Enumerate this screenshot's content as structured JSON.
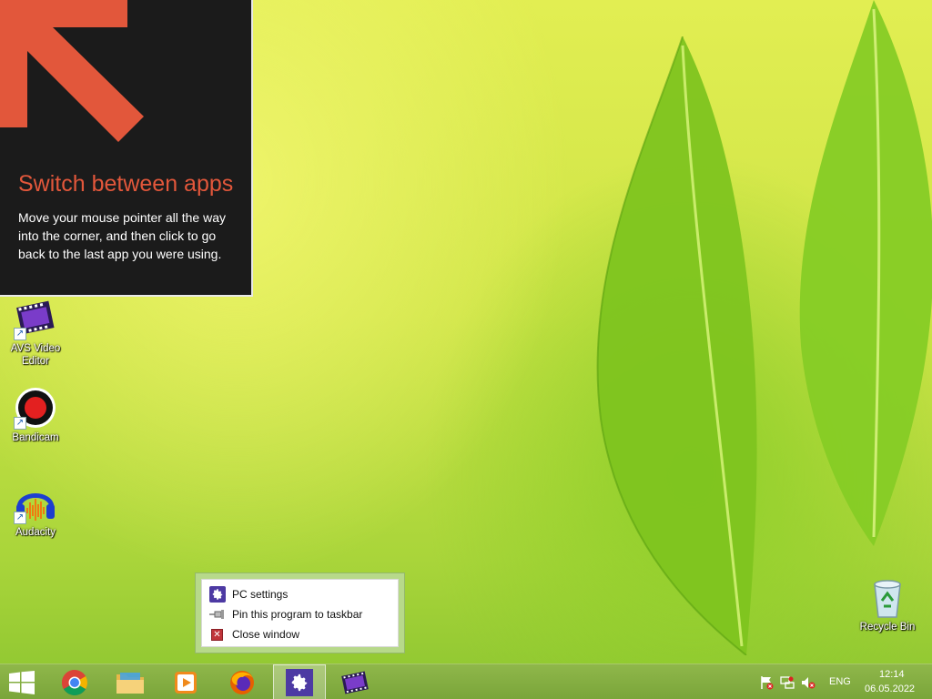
{
  "tip": {
    "title": "Switch between apps",
    "body": "Move your mouse pointer all the way into the corner, and then click to go back to the last app you were using."
  },
  "desktop": {
    "icons": [
      {
        "label": "AVS Video Editor",
        "icon": "film-icon"
      },
      {
        "label": "Bandicam",
        "icon": "record-icon"
      },
      {
        "label": "Audacity",
        "icon": "headphones-icon"
      },
      {
        "label": "Recycle Bin",
        "icon": "recycle-bin-icon"
      }
    ]
  },
  "jumplist": {
    "items": [
      {
        "label": "PC settings",
        "icon": "gear-icon"
      },
      {
        "label": "Pin this program to taskbar",
        "icon": "pin-icon"
      },
      {
        "label": "Close window",
        "icon": "close-icon"
      }
    ]
  },
  "taskbar": {
    "apps": [
      {
        "name": "start-button",
        "icon": "windows-logo-icon"
      },
      {
        "name": "chrome",
        "icon": "chrome-icon"
      },
      {
        "name": "file-explorer",
        "icon": "folder-icon"
      },
      {
        "name": "media-player",
        "icon": "media-player-icon"
      },
      {
        "name": "firefox",
        "icon": "firefox-icon"
      },
      {
        "name": "pc-settings",
        "icon": "gear-icon",
        "active": true
      },
      {
        "name": "avs-video-editor",
        "icon": "film-icon"
      }
    ],
    "tray": {
      "language": "ENG",
      "time": "12:14",
      "date": "06.05.2022"
    }
  },
  "colors": {
    "tip_title": "#e2573b",
    "tip_bg": "#1b1b1b",
    "taskbar": "#7aa53a",
    "jumplist_frame": "#b7d98a",
    "settings_purple": "#4d3aa3"
  }
}
